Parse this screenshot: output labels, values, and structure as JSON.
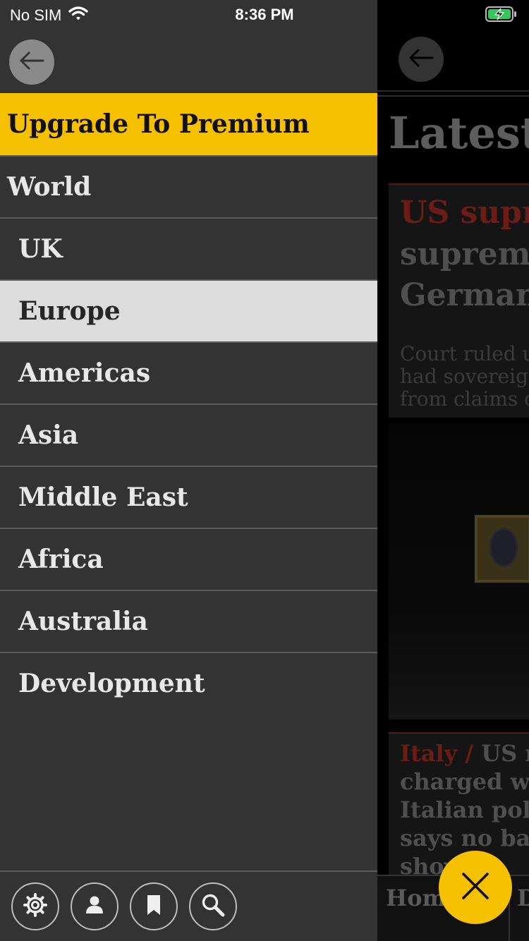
{
  "status_bar": {
    "carrier": "No SIM",
    "time": "8:36 PM",
    "icons": [
      "wifi-icon",
      "battery-charging-icon"
    ]
  },
  "drawer": {
    "back_icon": "arrow-left-icon",
    "premium_label": "Upgrade To Premium",
    "items": [
      {
        "label": "World",
        "level": "top"
      },
      {
        "label": "UK",
        "level": "sub"
      },
      {
        "label": "Europe",
        "level": "sub",
        "selected": true
      },
      {
        "label": "Americas",
        "level": "sub"
      },
      {
        "label": "Asia",
        "level": "sub"
      },
      {
        "label": "Middle East",
        "level": "sub"
      },
      {
        "label": "Africa",
        "level": "sub"
      },
      {
        "label": "Australia",
        "level": "sub"
      },
      {
        "label": "Development",
        "level": "sub"
      }
    ],
    "toolbar_icons": [
      "settings-icon",
      "profile-icon",
      "bookmark-icon",
      "search-icon"
    ]
  },
  "main": {
    "heading": "Latest r",
    "card1": {
      "kicker": "US supre",
      "headline_line1": "supreme",
      "headline_line2": "Germany",
      "summary_line1": "Court ruled ur",
      "summary_line2": "had sovereign",
      "summary_line3": "from claims ov"
    },
    "card2": {
      "kicker": "Italy /",
      "headline_line1": " US ma",
      "headline_line2": "charged with",
      "headline_line3": "Italian police",
      "headline_line4": "says no badg",
      "headline_line5": "shov"
    },
    "tabbar": {
      "home": "Home",
      "next": "D"
    }
  },
  "colors": {
    "accent_yellow": "#f5c000",
    "drawer_bg": "#333333",
    "selected_bg": "#dcdcdc",
    "kicker_red": "#6b1c14"
  },
  "fab": {
    "icon": "close-icon"
  }
}
